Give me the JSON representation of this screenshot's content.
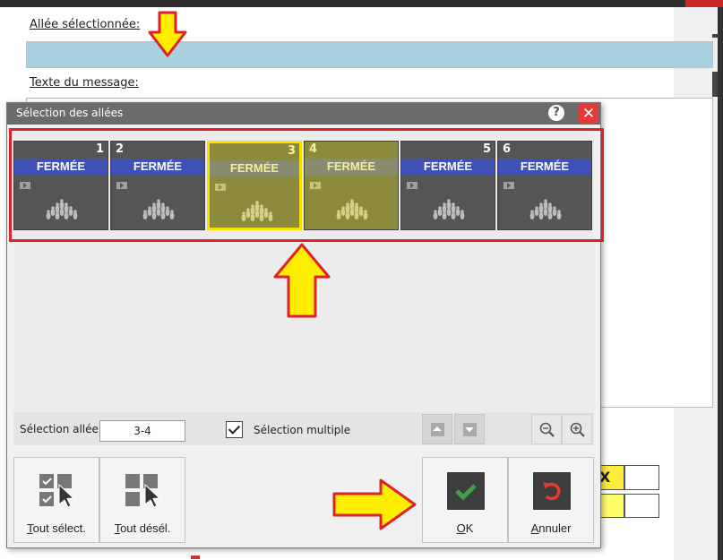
{
  "background": {
    "allee_label": "Allée sélectionnée:",
    "texte_label": "Texte du message:",
    "cell_x": "X"
  },
  "dialog": {
    "title": "Sélection des allées",
    "help": "?",
    "close": "✕",
    "lanes": [
      {
        "number": "1",
        "status": "FERMÉE",
        "selected": false
      },
      {
        "number": "2",
        "status": "FERMÉE",
        "selected": false
      },
      {
        "number": "3",
        "status": "FERMÉE",
        "selected": true
      },
      {
        "number": "4",
        "status": "FERMÉE",
        "selected": true
      },
      {
        "number": "5",
        "status": "FERMÉE",
        "selected": false
      },
      {
        "number": "6",
        "status": "FERMÉE",
        "selected": false
      }
    ],
    "selection_label": "Sélection allée",
    "selection_value": "3-4",
    "multi_label": "Sélection multiple",
    "multi_checked": true,
    "buttons": {
      "select_all": "Tout sélect.",
      "deselect_all": "Tout désél.",
      "ok": "OK",
      "cancel": "Annuler"
    }
  },
  "colors": {
    "lane_closed_bg": "#555555",
    "lane_status_blue": "#3f51b5",
    "lane_selected_bg": "#8c8a3c",
    "focus_yellow": "#f7e000",
    "annotation_red": "#e0202a",
    "annotation_yellow": "#ffee00",
    "ok_green": "#43a047",
    "cancel_red": "#e53935"
  },
  "icons": {
    "help": "help-icon",
    "close": "close-icon",
    "lane_pins": "bowling-pins-icon",
    "lane_play": "play-icon",
    "nav_up": "chevron-up-icon",
    "nav_down": "chevron-down-icon",
    "zoom_out": "zoom-out-icon",
    "zoom_in": "zoom-in-icon",
    "select_all": "select-all-icon",
    "deselect_all": "deselect-all-icon",
    "ok": "check-icon",
    "cancel": "undo-icon"
  }
}
